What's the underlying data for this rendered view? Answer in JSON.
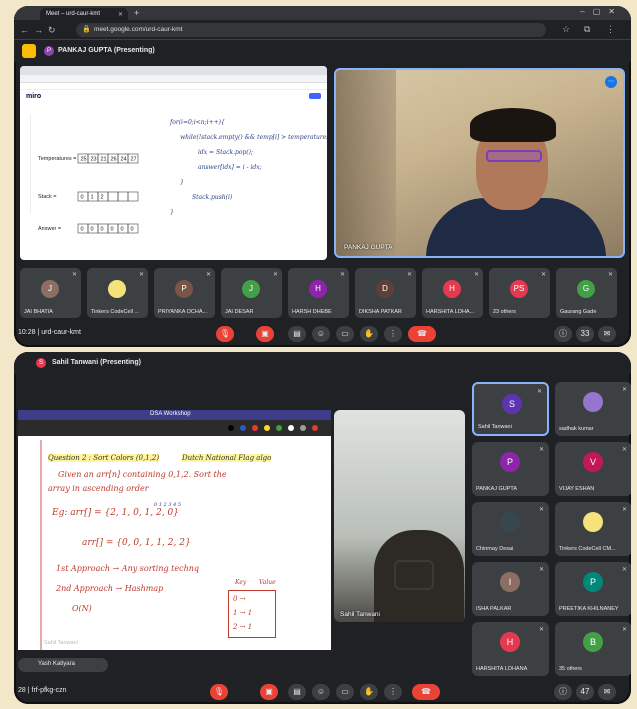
{
  "top_window": {
    "tab_title": "Meet – urd-caur-kmt",
    "url": "meet.google.com/urd-caur-kmt",
    "presenter_label": "PANKAJ GUPTA (Presenting)",
    "presenter_initial": "P",
    "shared_screen": {
      "app": "miro",
      "board_labels": [
        "Temperatures",
        "Stack",
        "Answer"
      ],
      "temperatures": [
        "25",
        "23",
        "21",
        "26",
        "24",
        "27"
      ],
      "stack": [
        "0",
        "1",
        "2",
        "",
        "",
        ""
      ],
      "answer": [
        "0",
        "0",
        "0",
        "0",
        "0",
        "0"
      ],
      "code_lines": [
        "for(i=0;i<n;i++){",
        "while(!stack.empty() && temp[i] > temperatures.peek()){",
        "idx = Stack.pop();",
        "answer[idx] = i - idx;",
        "}",
        "Stack.push(i)",
        "}"
      ]
    },
    "camera": {
      "name": "PANKAJ GUPTA"
    },
    "participants": [
      {
        "initial": "J",
        "name": "JAI BHATIA",
        "color": "#8d6e63"
      },
      {
        "initial": "",
        "name": "Tinkers CodeCell ...",
        "color": "#f6e27a"
      },
      {
        "initial": "P",
        "name": "PRIYANKA OCHA...",
        "color": "#795548"
      },
      {
        "initial": "J",
        "name": "JAI DESAR",
        "color": "#43a047"
      },
      {
        "initial": "H",
        "name": "HARSH DHEBE",
        "color": "#8e24aa"
      },
      {
        "initial": "D",
        "name": "DIKSHA PATKAR",
        "color": "#5d4037"
      },
      {
        "initial": "H",
        "name": "HARSHITA LOHA...",
        "color": "#e53950"
      },
      {
        "initial": "PS",
        "name": "23 others",
        "color": "#e53950"
      },
      {
        "initial": "G",
        "name": "Gaurang Gade",
        "color": "#43a047"
      }
    ],
    "control_bar": {
      "time": "10:28",
      "meeting_code": "urd-caur-kmt",
      "people_count": "33"
    }
  },
  "bottom_window": {
    "presenter_label": "Sahil Tanwani (Presenting)",
    "presenter_initial": "S",
    "shared_screen": {
      "doc_title": "DSA Workshop",
      "lines": [
        "Question 2 : Sort Colors (0,1,2)",
        "Dutch National Flag algo",
        "Given an arr[n] containing 0,1,2. Sort the",
        "array in ascending order",
        "Eg:   arr[] = {2, 1, 0, 1, 2, 0}",
        "arr[] = {0, 0, 1, 1, 2, 2}",
        "1st Approach → Any sorting technq",
        "2nd Approach → Hashmap",
        "O(N)"
      ],
      "index_row": "0   1   2   3   4   5",
      "table_header": [
        "Key",
        "Value"
      ],
      "table_rows": [
        "0 →",
        "1 → 1",
        "2 → 1"
      ],
      "presenter_footer": "Sahil Tanwani"
    },
    "camera": {
      "name": "Sahil Tanwani"
    },
    "self_view": "Yash Katiyara",
    "grid": [
      {
        "initial": "S",
        "name": "Sahil Tanwani",
        "color": "#5e35b1",
        "active": true
      },
      {
        "initial": "",
        "name": "sadhak kumar",
        "color": "#9575cd",
        "active": false
      },
      {
        "initial": "P",
        "name": "PANKAJ GUPTA",
        "color": "#8e24aa",
        "active": false
      },
      {
        "initial": "V",
        "name": "VIJAY ESHAN",
        "color": "#c2185b",
        "active": false
      },
      {
        "initial": "",
        "name": "Chinmay Desai",
        "color": "#37474f",
        "active": false
      },
      {
        "initial": "",
        "name": "Tinkers CodeCell CM...",
        "color": "#f6e27a",
        "active": false
      },
      {
        "initial": "I",
        "name": "ISHA PALKAR",
        "color": "#8d6e63",
        "active": false
      },
      {
        "initial": "P",
        "name": "PREETIKA KHILNANEY",
        "color": "#00897b",
        "active": false
      },
      {
        "initial": "H",
        "name": "HARSHITA LOHANA",
        "color": "#e53950",
        "active": false
      },
      {
        "initial": "B",
        "name": "35 others",
        "color": "#43a047",
        "active": false
      }
    ],
    "control_bar": {
      "time": "28",
      "meeting_code": "frf-pfkg-czn",
      "people_count": "47"
    }
  }
}
